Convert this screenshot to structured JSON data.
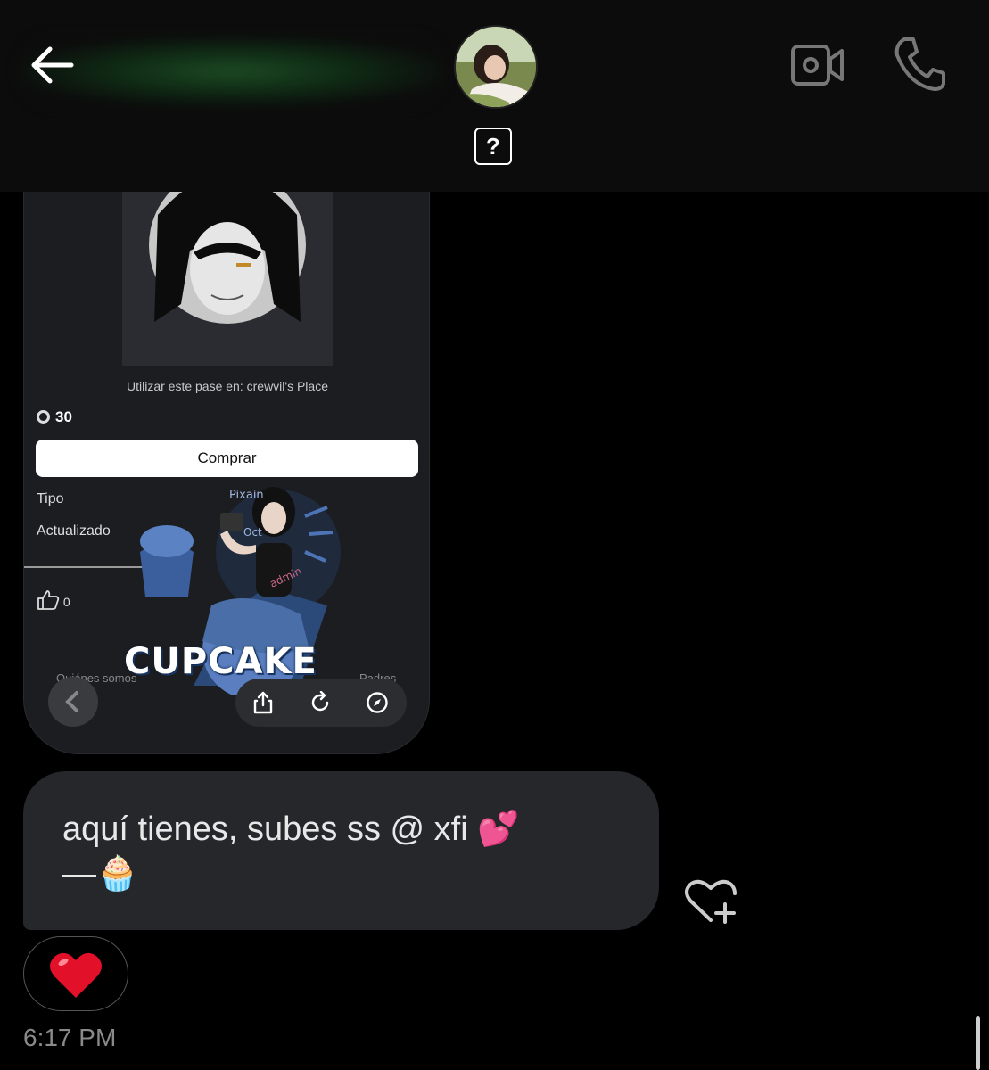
{
  "header": {
    "back_icon": "arrow-left-icon",
    "avatar_icon": "contact-avatar",
    "unknown_badge": "?",
    "video_icon": "video-camera-icon",
    "call_icon": "phone-icon"
  },
  "shared_screenshot": {
    "caption": "Utilizar este pase en: crewvil's Place",
    "price": "30",
    "buy_label": "Comprar",
    "type_label": "Tipo",
    "updated_label": "Actualizado",
    "likes_count": "0",
    "sticker_text": "CUPCAKE",
    "sticker_tag": "admin",
    "sticker_brand": "Pixain",
    "sticker_side": "Oct",
    "cut_left": "Quiénes somos",
    "cut_right": "Padres",
    "toolbar_icons": [
      "share-icon",
      "reload-icon",
      "compass-icon"
    ]
  },
  "message": {
    "line1": "aquí tienes, subes ss @ xfi 💕",
    "line2": "—🧁"
  },
  "reaction": {
    "emoji": "❤️"
  },
  "timestamp": "6:17 PM",
  "colors": {
    "background": "#000000",
    "bubble": "#25272b",
    "header": "#0c0c0c"
  }
}
